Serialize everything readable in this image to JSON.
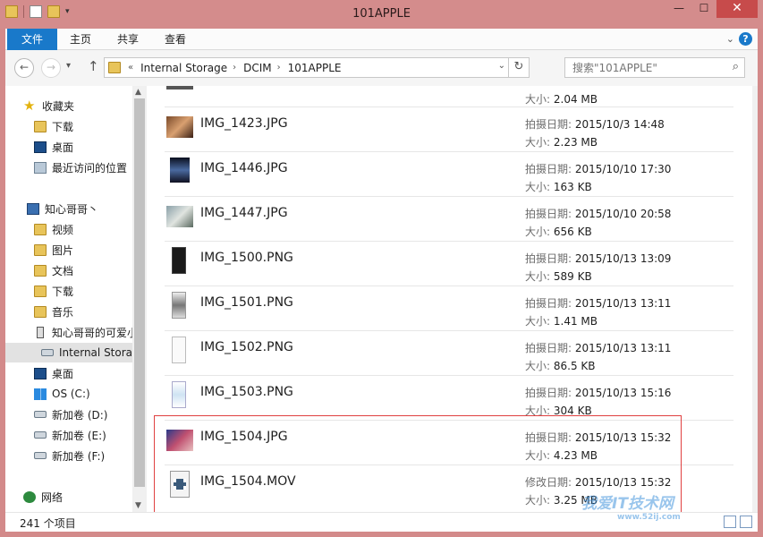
{
  "window": {
    "title": "101APPLE"
  },
  "ribbon": {
    "tabs": [
      "文件",
      "主页",
      "共享",
      "查看"
    ]
  },
  "address": {
    "crumbs": [
      "Internal Storage",
      "DCIM",
      "101APPLE"
    ]
  },
  "search": {
    "placeholder": "搜索\"101APPLE\""
  },
  "sidebar": {
    "items": [
      {
        "label": "收藏夹"
      },
      {
        "label": "下载"
      },
      {
        "label": "桌面"
      },
      {
        "label": "最近访问的位置"
      },
      {
        "label": "知心哥哥丶"
      },
      {
        "label": "视频"
      },
      {
        "label": "图片"
      },
      {
        "label": "文档"
      },
      {
        "label": "下载"
      },
      {
        "label": "音乐"
      },
      {
        "label": "知心哥哥的可爱小"
      },
      {
        "label": "Internal Storage"
      },
      {
        "label": "桌面"
      },
      {
        "label": "OS (C:)"
      },
      {
        "label": "新加卷 (D:)"
      },
      {
        "label": "新加卷 (E:)"
      },
      {
        "label": "新加卷 (F:)"
      },
      {
        "label": "网络"
      }
    ]
  },
  "files": [
    {
      "size_label": "大小:",
      "size": "2.04 MB"
    },
    {
      "name": "IMG_1423.JPG",
      "date_label": "拍摄日期:",
      "date": "2015/10/3 14:48",
      "size_label": "大小:",
      "size": "2.23 MB"
    },
    {
      "name": "IMG_1446.JPG",
      "date_label": "拍摄日期:",
      "date": "2015/10/10 17:30",
      "size_label": "大小:",
      "size": "163 KB"
    },
    {
      "name": "IMG_1447.JPG",
      "date_label": "拍摄日期:",
      "date": "2015/10/10 20:58",
      "size_label": "大小:",
      "size": "656 KB"
    },
    {
      "name": "IMG_1500.PNG",
      "date_label": "拍摄日期:",
      "date": "2015/10/13 13:09",
      "size_label": "大小:",
      "size": "589 KB"
    },
    {
      "name": "IMG_1501.PNG",
      "date_label": "拍摄日期:",
      "date": "2015/10/13 13:11",
      "size_label": "大小:",
      "size": "1.41 MB"
    },
    {
      "name": "IMG_1502.PNG",
      "date_label": "拍摄日期:",
      "date": "2015/10/13 13:11",
      "size_label": "大小:",
      "size": "86.5 KB"
    },
    {
      "name": "IMG_1503.PNG",
      "date_label": "拍摄日期:",
      "date": "2015/10/13 15:16",
      "size_label": "大小:",
      "size": "304 KB"
    },
    {
      "name": "IMG_1504.JPG",
      "date_label": "拍摄日期:",
      "date": "2015/10/13 15:32",
      "size_label": "大小:",
      "size": "4.23 MB"
    },
    {
      "name": "IMG_1504.MOV",
      "date_label": "修改日期:",
      "date": "2015/10/13 15:32",
      "size_label": "大小:",
      "size": "3.25 MB"
    }
  ],
  "status": {
    "count": "241 个项目"
  },
  "watermark": {
    "text": "我爱IT技术网",
    "sub": "www.52ij.com"
  },
  "colors": {
    "accent": "#1979ca",
    "titlebar": "#d48c8c",
    "highlight_box": "#e04040"
  }
}
